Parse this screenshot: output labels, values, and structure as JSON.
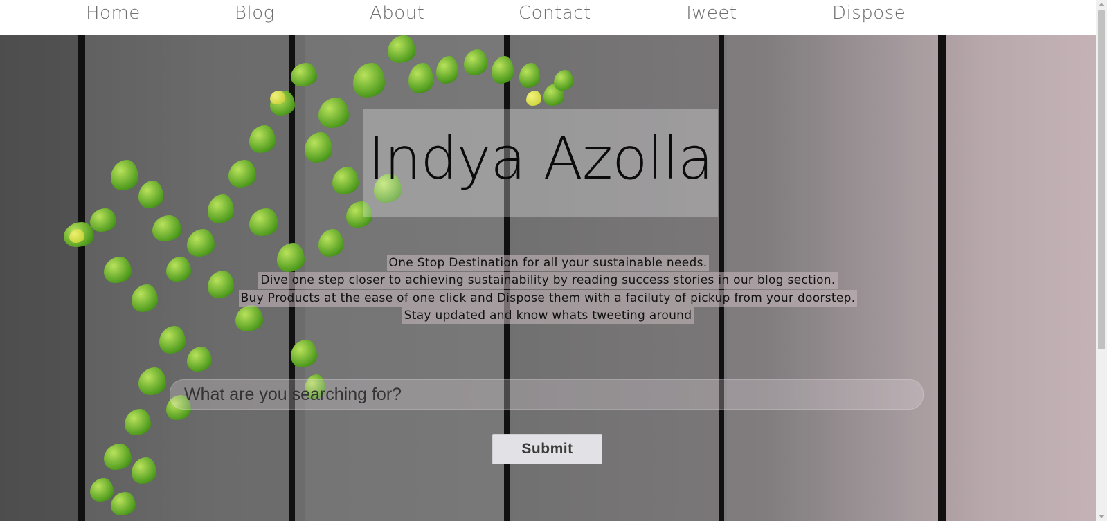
{
  "nav": {
    "items": [
      {
        "label": "Home"
      },
      {
        "label": "Blog"
      },
      {
        "label": "About"
      },
      {
        "label": "Contact"
      },
      {
        "label": "Tweet"
      },
      {
        "label": "Dispose"
      }
    ]
  },
  "hero": {
    "title": "Indya Azolla",
    "taglines": [
      "One Stop Destination for all your sustainable needs.",
      "Dive one step closer to achieving sustainability by reading success stories in our blog section.",
      "Buy Products at the ease of one click and Dispose them with a faciluty of pickup from your doorstep.",
      "Stay updated and know whats tweeting around"
    ]
  },
  "search": {
    "placeholder": "What are you searching for?",
    "value": ""
  },
  "form": {
    "submit_label": "Submit"
  },
  "colors": {
    "nav_text": "#6f6f6f",
    "title_text": "#0b0b0b",
    "button_bg": "#e2e2e6",
    "vine_green": "#4f9b1e"
  }
}
